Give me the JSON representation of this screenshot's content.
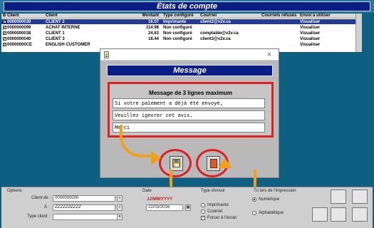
{
  "window": {
    "title": "États de compte"
  },
  "grid": {
    "headers": [
      "B",
      "Client",
      "Client",
      "Montant",
      "Type configuré",
      "Courriel",
      "Courriels refusés",
      "Envoi à utiliser"
    ],
    "rows": [
      {
        "checked": true,
        "num": "0000000039",
        "name": "CLIENT 2",
        "amount": "16.07",
        "type": "Imprimante",
        "email": "client2@v2v.ca",
        "refused": "",
        "action": "Visualiser",
        "selected": true
      },
      {
        "checked": true,
        "num": "0000000099",
        "name": "ACHAT INTERNE",
        "amount": "114.98",
        "type": "Non configuré",
        "email": "",
        "refused": "",
        "action": "Visualiser",
        "selected": false
      },
      {
        "checked": true,
        "num": "0000000038",
        "name": "CLIENT 1",
        "amount": "24.63",
        "type": "Non configuré",
        "email": "comptable@v2v.ca",
        "refused": "",
        "action": "Visualiser",
        "selected": false
      },
      {
        "checked": true,
        "num": "0000000040",
        "name": "CLIENT 3",
        "amount": "18.44",
        "type": "Non configuré",
        "email": "client3@v2v.ca",
        "refused": "",
        "action": "Visualiser",
        "selected": false
      },
      {
        "checked": true,
        "num": "00000000CE",
        "name": "ENGLISH CUSTOMER",
        "amount": "",
        "type": "",
        "email": "",
        "refused": "",
        "action": "Visualiser",
        "selected": false
      }
    ]
  },
  "dialog": {
    "header": "Message",
    "subtitle": "Message de 3 lignes maximum",
    "lines": [
      "Si votre paiement a déjà été envoyé,",
      "Veuillez ignorer cet avis.",
      "Merci"
    ],
    "ok_icon": "floppy-save-icon",
    "exit_icon": "exit-door-icon",
    "exit_text": "EXIT",
    "close_glyph": "×"
  },
  "options": {
    "group_label": "Options",
    "client_de_label": "Client de :",
    "client_de_value": "0000000000",
    "a_label": "À :",
    "a_value": "ZZZZZZZZZZ",
    "type_client_label": "Type client :",
    "type_client_value": "",
    "date_label": "Date",
    "date_format": "JJ/MM/YYYY",
    "date_value": "22/03/2016",
    "envoi_label": "Type d'envoi",
    "envoi_opts": [
      "Imprimante",
      "Courriel"
    ],
    "forcer_label": "Forcer à l'écran",
    "tri_label": "Tri lors de l'impression",
    "tri_opts": [
      "Numérique",
      "Alphabétique"
    ]
  },
  "colors": {
    "accent_red": "#e01f1f",
    "arrow_orange": "#f2a016",
    "title_blue": "#0a1e86"
  }
}
